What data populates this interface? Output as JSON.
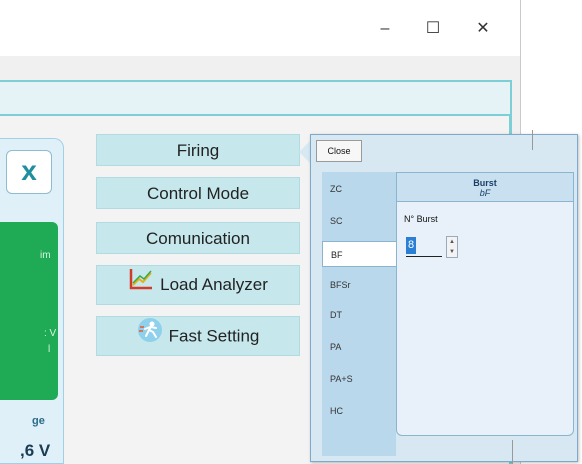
{
  "window": {
    "minimize": "–",
    "maximize": "☐",
    "close": "✕"
  },
  "left_panel": {
    "x_label": "x",
    "green_text_1": "im",
    "green_text_2": ": V",
    "green_text_3": "l",
    "stage_label": "ge",
    "voltage_value": ",6",
    "voltage_unit": "V"
  },
  "menu": {
    "firing": "Firing",
    "control_mode": "Control Mode",
    "comunication": "Comunication",
    "load_analyzer": "Load Analyzer",
    "fast_setting": "Fast Setting",
    "icons": [
      "chart-icon",
      "running-figure-icon"
    ]
  },
  "firing_popup": {
    "close_label": "Close",
    "tabs": [
      "ZC",
      "SC",
      "BF",
      "BFSr",
      "DT",
      "PA",
      "PA+S",
      "HC"
    ],
    "selected_tab": "BF",
    "panel_title": "Burst",
    "panel_subtitle": "bF",
    "burst_label": "N° Burst",
    "burst_value": "8"
  },
  "colors": {
    "accent_teal": "#7ccfd5",
    "menu_bg": "#c6e8ec",
    "green_status": "#1faa55",
    "selection_blue": "#2a7fd4"
  }
}
